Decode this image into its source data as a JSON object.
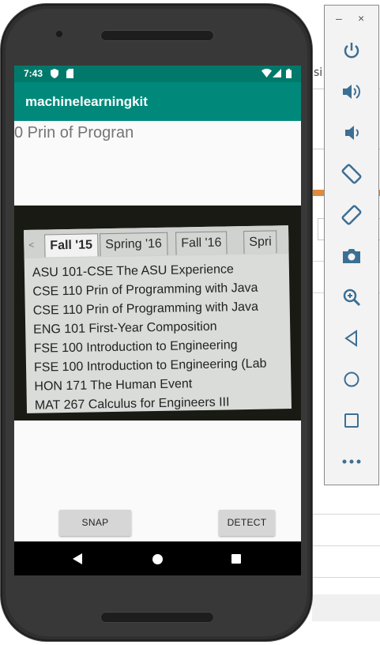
{
  "background": {
    "fragment_text": "si"
  },
  "statusbar": {
    "time": "7:43",
    "icons": [
      "shield-icon",
      "sd-card-icon",
      "wifi-icon",
      "signal-icon",
      "battery-icon"
    ]
  },
  "appbar": {
    "title": "machinelearningkit"
  },
  "result_text": "0 Prin of Progran",
  "photo": {
    "tabs": [
      "Fall '15",
      "Spring '16",
      "Fall '16",
      "Spri"
    ],
    "courses": [
      "ASU 101-CSE The ASU Experience",
      "CSE 110 Prin of Programming with Java",
      "CSE 110 Prin of Programming with Java",
      "ENG 101 First-Year Composition",
      "FSE 100 Introduction to Engineering",
      "FSE 100 Introduction to Engineering (Lab",
      "HON 171 The Human Event",
      "MAT 267 Calculus for Engineers III"
    ]
  },
  "buttons": {
    "snap": "SNAP",
    "detect": "DETECT"
  },
  "navbar": [
    "back-icon",
    "home-icon",
    "recents-icon"
  ],
  "toolbar": {
    "minimize": "–",
    "close": "×",
    "items": [
      "power-icon",
      "volume-up-icon",
      "volume-down-icon",
      "rotate-left-icon",
      "rotate-right-icon",
      "camera-icon",
      "zoom-icon",
      "back-icon",
      "home-icon",
      "overview-icon",
      "more-icon"
    ]
  },
  "colors": {
    "statusbar": "#00796b",
    "appbar": "#00897b",
    "toolbar_icon": "#3c6f93"
  }
}
